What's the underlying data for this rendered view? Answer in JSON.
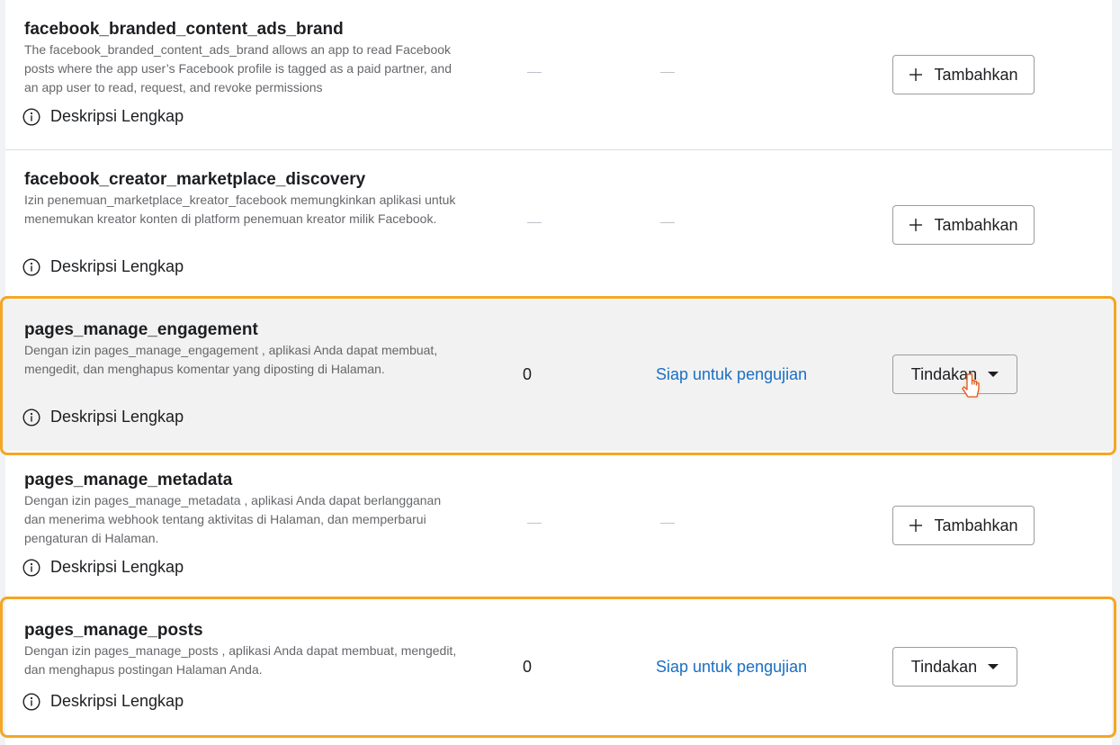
{
  "full_description_label": "Deskripsi Lengkap",
  "add_label": "Tambahkan",
  "action_label": "Tindakan",
  "dash_glyph": "—",
  "colors": {
    "highlight": "#f5a623",
    "link": "#1a6fc4",
    "hover_row": "#f2f2f2"
  },
  "permissions": [
    {
      "name": "facebook_branded_content_ads_brand",
      "description": "The facebook_branded_content_ads_brand allows an app to read Facebook posts where the app user’s Facebook profile is tagged as a paid partner, and an app user to read, request, and revoke permissions",
      "count": "",
      "status": "",
      "button": "add"
    },
    {
      "name": "facebook_creator_marketplace_discovery",
      "description": "Izin penemuan_marketplace_kreator_facebook memungkinkan aplikasi untuk menemukan kreator konten di platform penemuan kreator milik Facebook.",
      "count": "",
      "status": "",
      "button": "add"
    },
    {
      "name": "pages_manage_engagement",
      "description": "Dengan izin pages_manage_engagement , aplikasi Anda dapat membuat, mengedit, dan menghapus komentar yang diposting di Halaman.",
      "count": "0",
      "status": "Siap untuk pengujian",
      "button": "action"
    },
    {
      "name": "pages_manage_metadata",
      "description": "Dengan izin pages_manage_metadata , aplikasi Anda dapat berlangganan dan menerima webhook tentang aktivitas di Halaman, dan memperbarui pengaturan di Halaman.",
      "count": "",
      "status": "",
      "button": "add"
    },
    {
      "name": "pages_manage_posts",
      "description": "Dengan izin pages_manage_posts , aplikasi Anda dapat membuat, mengedit, dan menghapus postingan Halaman Anda.",
      "count": "0",
      "status": "Siap untuk pengujian",
      "button": "action"
    }
  ]
}
